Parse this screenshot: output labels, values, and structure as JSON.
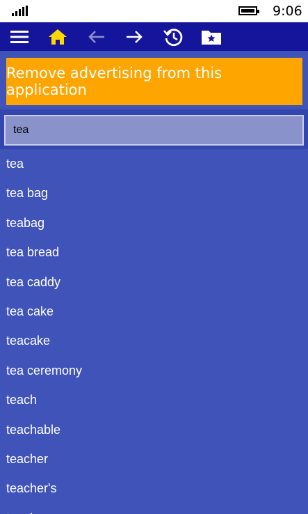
{
  "status_bar": {
    "time": "9:06"
  },
  "toolbar": {
    "buttons": [
      {
        "icon": "menu-icon"
      },
      {
        "icon": "home-icon",
        "color": "#ffd800"
      },
      {
        "icon": "back-arrow-icon",
        "state": "disabled"
      },
      {
        "icon": "forward-arrow-icon"
      },
      {
        "icon": "history-icon"
      },
      {
        "icon": "favorites-folder-icon"
      }
    ]
  },
  "ad": {
    "label": "Remove advertising from this application",
    "color": "#ffa500"
  },
  "search": {
    "value": "tea"
  },
  "results": [
    "tea",
    "tea bag",
    "teabag",
    "tea bread",
    "tea caddy",
    "tea cake",
    "teacake",
    "tea ceremony",
    "teach",
    "teachable",
    "teacher",
    "teacher's",
    "teach"
  ],
  "colors": {
    "background": "#3f53b8",
    "toolbar": "#14159a",
    "accent": "#ffd800"
  }
}
